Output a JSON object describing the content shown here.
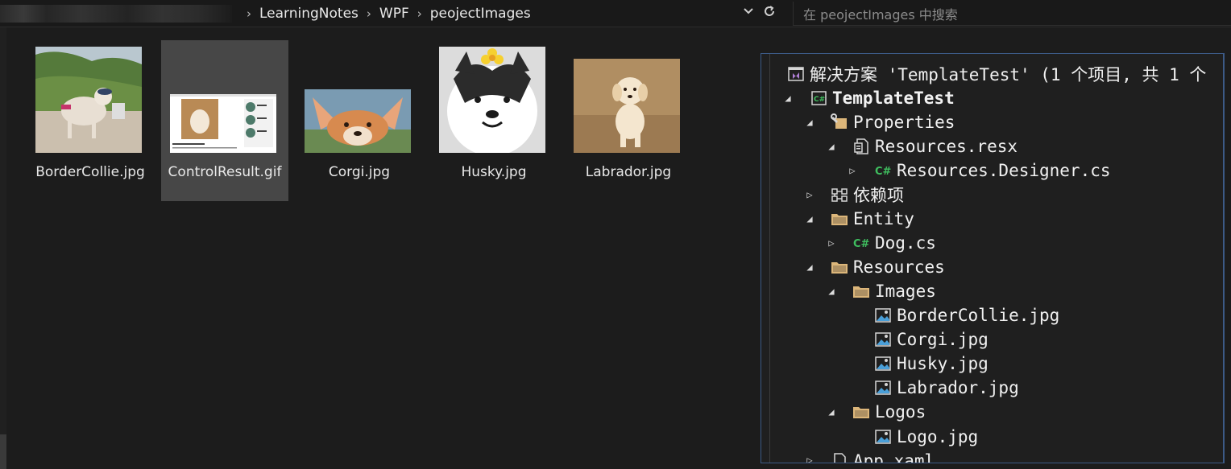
{
  "address_bar": {
    "crumbs": [
      "LearningNotes",
      "WPF",
      "peojectImages"
    ],
    "search_placeholder": "在 peojectImages 中搜索"
  },
  "files": [
    {
      "name": "BorderCollie.jpg",
      "icon": "border-collie-thumbnail"
    },
    {
      "name": "ControlResult.gif",
      "icon": "control-result-thumbnail"
    },
    {
      "name": "Corgi.jpg",
      "icon": "corgi-thumbnail"
    },
    {
      "name": "Husky.jpg",
      "icon": "husky-thumbnail"
    },
    {
      "name": "Labrador.jpg",
      "icon": "labrador-thumbnail"
    }
  ],
  "solution_explorer": {
    "solution": "解决方案 'TemplateTest' (1 个项目, 共 1 个",
    "nodes": [
      {
        "label": "TemplateTest",
        "icon": "csharp-project-icon",
        "expanded": true
      },
      {
        "label": "Properties",
        "icon": "properties-icon",
        "expanded": true
      },
      {
        "label": "Resources.resx",
        "icon": "resx-file-icon",
        "expanded": true
      },
      {
        "label": "Resources.Designer.cs",
        "icon": "csharp-file-icon",
        "expanded": false
      },
      {
        "label": "依赖项",
        "icon": "dependencies-icon",
        "expanded": false
      },
      {
        "label": "Entity",
        "icon": "folder-icon",
        "expanded": true
      },
      {
        "label": "Dog.cs",
        "icon": "csharp-file-icon",
        "expanded": false
      },
      {
        "label": "Resources",
        "icon": "folder-icon",
        "expanded": true
      },
      {
        "label": "Images",
        "icon": "folder-icon",
        "expanded": true
      },
      {
        "label": "BorderCollie.jpg",
        "icon": "image-file-icon"
      },
      {
        "label": "Corgi.jpg",
        "icon": "image-file-icon"
      },
      {
        "label": "Husky.jpg",
        "icon": "image-file-icon"
      },
      {
        "label": "Labrador.jpg",
        "icon": "image-file-icon"
      },
      {
        "label": "Logos",
        "icon": "folder-icon",
        "expanded": true
      },
      {
        "label": "Logo.jpg",
        "icon": "image-file-icon"
      },
      {
        "label": "App.xaml",
        "icon": "xaml-file-icon",
        "expanded": false
      }
    ]
  },
  "colors": {
    "background": "#1c1c1c",
    "selection": "#474747",
    "explorer_border": "#3c5a86",
    "csharp_green": "#3fbf5f",
    "folder_tan": "#dcb67a"
  }
}
